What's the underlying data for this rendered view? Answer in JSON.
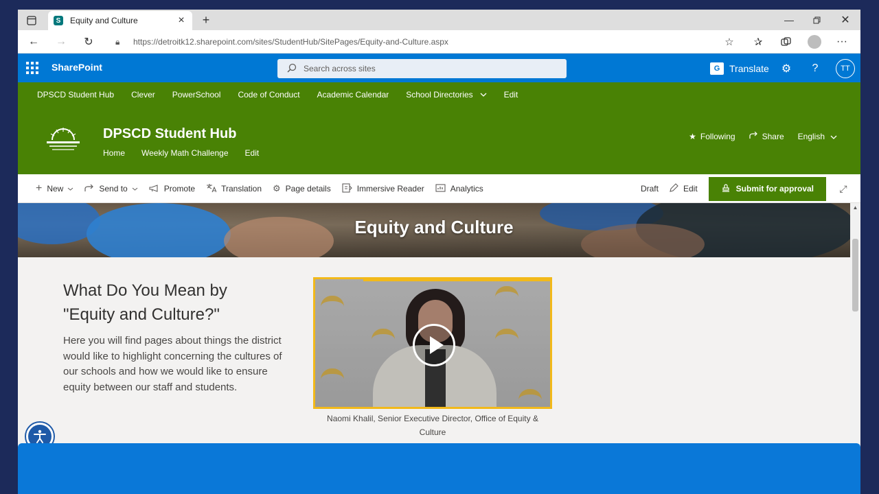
{
  "browser": {
    "tab_title": "Equity and Culture",
    "tab_favicon": "S",
    "url": "https://detroitk12.sharepoint.com/sites/StudentHub/SitePages/Equity-and-Culture.aspx"
  },
  "suitebar": {
    "brand": "SharePoint",
    "search_placeholder": "Search across sites",
    "translate_label": "Translate",
    "translate_icon_text": "G",
    "avatar_initials": "TT",
    "accent_color": "#0078d4"
  },
  "hubnav": {
    "items": [
      {
        "label": "DPSCD Student Hub"
      },
      {
        "label": "Clever"
      },
      {
        "label": "PowerSchool"
      },
      {
        "label": "Code of Conduct"
      },
      {
        "label": "Academic Calendar"
      },
      {
        "label": "School Directories"
      },
      {
        "label": "Edit"
      }
    ],
    "color": "#498205"
  },
  "site": {
    "title": "DPSCD Student Hub",
    "nav": [
      {
        "label": "Home"
      },
      {
        "label": "Weekly Math Challenge"
      },
      {
        "label": "Edit"
      }
    ],
    "actions": {
      "following": "Following",
      "share": "Share",
      "language": "English"
    }
  },
  "commandbar": {
    "left": [
      {
        "label": "New",
        "icon": "plus-icon"
      },
      {
        "label": "Send to",
        "icon": "send-icon"
      },
      {
        "label": "Promote",
        "icon": "megaphone-icon"
      },
      {
        "label": "Translation",
        "icon": "translation-icon"
      },
      {
        "label": "Page details",
        "icon": "gear-icon"
      },
      {
        "label": "Immersive Reader",
        "icon": "reader-icon"
      },
      {
        "label": "Analytics",
        "icon": "analytics-icon"
      }
    ],
    "status": "Draft",
    "edit": "Edit",
    "submit": "Submit for approval"
  },
  "page": {
    "banner_title": "Equity and Culture",
    "heading": "What Do You Mean by \"Equity and Culture?\"",
    "body": "Here you will find pages about things the district would like to highlight concerning the cultures of our schools and how we would like to ensure equity between our staff and students.",
    "video_caption": "Naomi Khalil, Senior Executive Director, Office of Equity & Culture",
    "video_border_color": "#f2b91a"
  }
}
